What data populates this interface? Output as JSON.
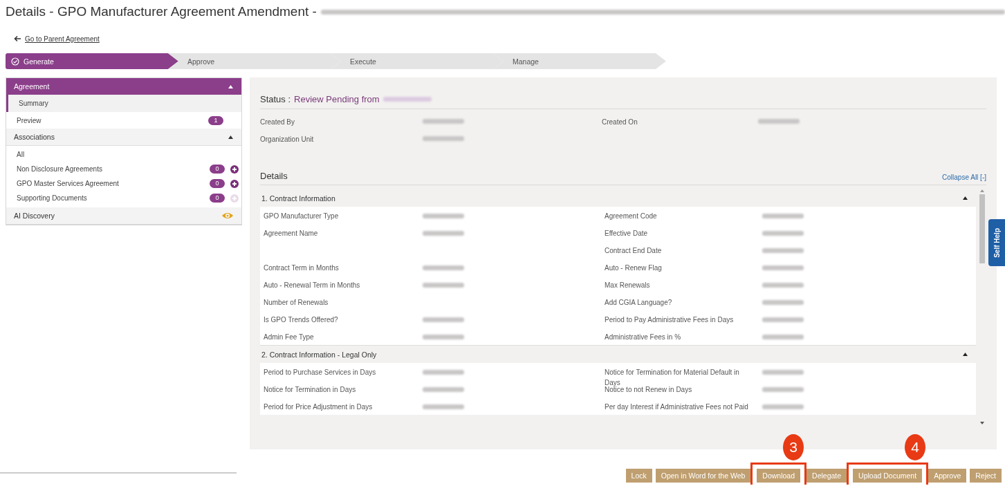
{
  "title": {
    "text": "Details - GPO Manufacturer Agreement Amendment - ",
    "suffix_blurred": true
  },
  "back_link": "Go to Parent Agreement",
  "steps": [
    {
      "label": "Generate",
      "selected": true
    },
    {
      "label": "Approve",
      "selected": false
    },
    {
      "label": "Execute",
      "selected": false
    },
    {
      "label": "Manage",
      "selected": false
    }
  ],
  "sidebar": {
    "groups": [
      {
        "kind": "section",
        "title": "Agreement",
        "selected": true,
        "expanded": true,
        "items": [
          {
            "label": "Summary",
            "selected": true
          },
          {
            "label": "Preview",
            "selected": false,
            "badge": "1"
          }
        ]
      },
      {
        "kind": "section",
        "title": "Associations",
        "selected": false,
        "expanded": true,
        "items": [
          {
            "label": "All",
            "selected": false
          },
          {
            "label": "Non Disclosure Agreements",
            "selected": false,
            "badge": "0",
            "add": {
              "disabled": false
            }
          },
          {
            "label": "GPO Master Services Agreement",
            "selected": false,
            "badge": "0",
            "add": {
              "disabled": false
            }
          },
          {
            "label": "Supporting Documents",
            "selected": false,
            "badge": "0",
            "add": {
              "disabled": true
            }
          }
        ]
      },
      {
        "kind": "viewer",
        "title": "AI Discovery",
        "selected": false
      }
    ]
  },
  "status": {
    "label": "Status :",
    "value": "Review Pending from",
    "name_blurred": true
  },
  "meta": [
    {
      "left": {
        "label": "Created By",
        "blurred": true
      },
      "right": {
        "label": "Created On",
        "blurred": true
      }
    },
    {
      "left": {
        "label": "Organization Unit",
        "blurred": true
      }
    }
  ],
  "details": {
    "heading": "Details",
    "collapse_link": "Collapse All [-]",
    "sections": [
      {
        "title": "1. Contract Information",
        "expanded": true,
        "rows": [
          {
            "left": {
              "label": "GPO Manufacturer Type",
              "blurred": true
            },
            "right": {
              "label": "Agreement Code",
              "blurred": true
            }
          },
          {
            "left": {
              "label": "Agreement Name",
              "blurred": true
            },
            "right": {
              "label": "Effective Date",
              "blurred": true
            }
          },
          {
            "right": {
              "label": "Contract End Date",
              "blurred": true
            }
          },
          {
            "left": {
              "label": "Contract Term in Months",
              "blurred": true
            },
            "right": {
              "label": "Auto - Renew Flag",
              "blurred": true
            }
          },
          {
            "left": {
              "label": "Auto - Renewal Term in Months",
              "blurred": true
            },
            "right": {
              "label": "Max Renewals",
              "blurred": true
            }
          },
          {
            "left": {
              "label": "Number of Renewals",
              "blurred": false
            },
            "right": {
              "label": "Add CGIA Language?",
              "blurred": true
            }
          },
          {
            "left": {
              "label": "Is GPO Trends Offered?",
              "blurred": true
            },
            "right": {
              "label": "Period to Pay Administrative Fees in Days",
              "blurred": true
            }
          },
          {
            "left": {
              "label": "Admin Fee Type",
              "blurred": true
            },
            "right": {
              "label": "Administrative Fees in %",
              "blurred": true
            }
          }
        ]
      },
      {
        "title": "2. Contract Information - Legal Only",
        "expanded": true,
        "rows": [
          {
            "left": {
              "label": "Period to Purchase Services in Days",
              "blurred": true
            },
            "right": {
              "label": "Notice for Termination for Material Default in Days",
              "blurred": true
            }
          },
          {
            "left": {
              "label": "Notice for Termination in Days",
              "blurred": true
            },
            "right": {
              "label": "Notice to not Renew in Days",
              "blurred": true
            }
          },
          {
            "left": {
              "label": "Period for Price Adjustment in Days",
              "blurred": true
            },
            "right": {
              "label": "Per day Interest if Administrative Fees not Paid",
              "blurred": true
            }
          }
        ]
      }
    ]
  },
  "self_help": "Self Help",
  "actions": [
    {
      "label": "Lock"
    },
    {
      "label": "Open in Word for the Web"
    },
    {
      "label": "Download",
      "callout": "3"
    },
    {
      "label": "Delegate"
    },
    {
      "label": "Upload Document",
      "callout": "4"
    },
    {
      "label": "Approve"
    },
    {
      "label": "Reject"
    }
  ]
}
